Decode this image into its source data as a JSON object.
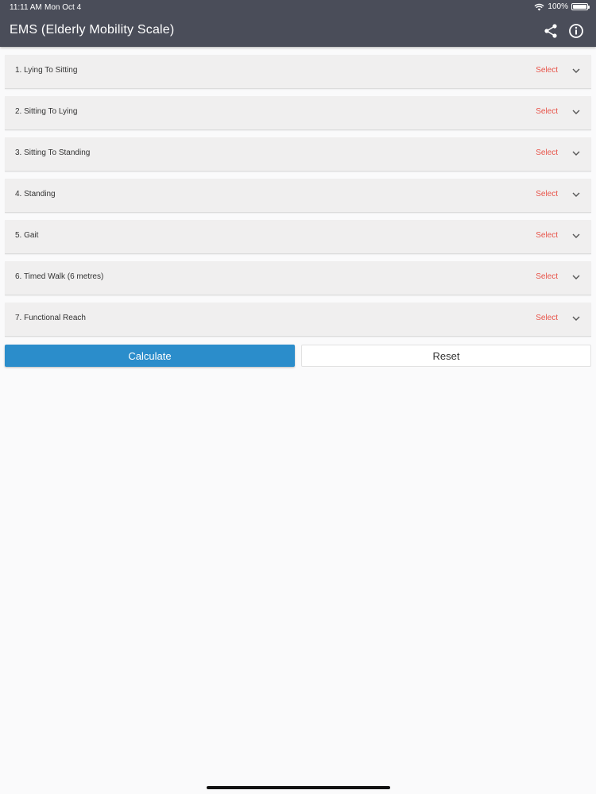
{
  "status": {
    "time": "11:11 AM",
    "date": "Mon Oct 4",
    "battery": "100%"
  },
  "header": {
    "title": "EMS (Elderly Mobility Scale)",
    "share_icon": "share-icon",
    "info_icon": "info-icon"
  },
  "items": [
    {
      "label": "1. Lying To Sitting",
      "value": "Select"
    },
    {
      "label": "2. Sitting To Lying",
      "value": "Select"
    },
    {
      "label": "3. Sitting To Standing",
      "value": "Select"
    },
    {
      "label": "4. Standing",
      "value": "Select"
    },
    {
      "label": "5. Gait",
      "value": "Select"
    },
    {
      "label": "6. Timed Walk (6 metres)",
      "value": "Select"
    },
    {
      "label": "7. Functional Reach",
      "value": "Select"
    }
  ],
  "buttons": {
    "calculate": "Calculate",
    "reset": "Reset"
  },
  "colors": {
    "header": "#4a4d59",
    "accent": "#2b8dcb",
    "select_text": "#e8554b"
  }
}
